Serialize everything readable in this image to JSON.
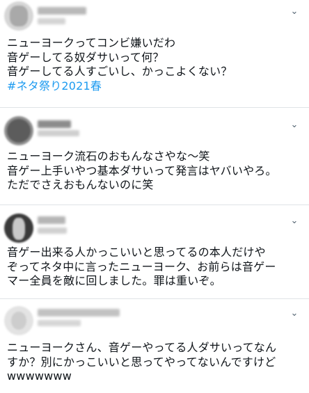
{
  "tweets": [
    {
      "lines": [
        "ニューヨークってコンビ嫌いだわ",
        "音ゲーしてる奴ダサいって何？",
        "音ゲーしてる人すごいし、かっこよくない？"
      ],
      "hashtag": "#ネタ祭り2021春"
    },
    {
      "lines": [
        "ニューヨーク流石のおもんなさやな～笑",
        "音ゲー上手いやつ基本ダサいって発言はヤバいやろ。",
        "ただでさえおもんないのに笑"
      ]
    },
    {
      "lines": [
        "音ゲー出来る人かっこいいと思ってるの本人だけや",
        "ぞってネタ中に言ったニューヨーク、お前らは音ゲー",
        "マー全員を敵に回しました。罪は重いぞ。"
      ]
    },
    {
      "lines": [
        "ニューヨークさん、音ゲーやってる人ダサいってなん",
        "すか？別にかっこいいと思ってやってないんですけど",
        "wwwwwww"
      ]
    }
  ],
  "icons": {
    "more": "chevron-down-icon"
  }
}
